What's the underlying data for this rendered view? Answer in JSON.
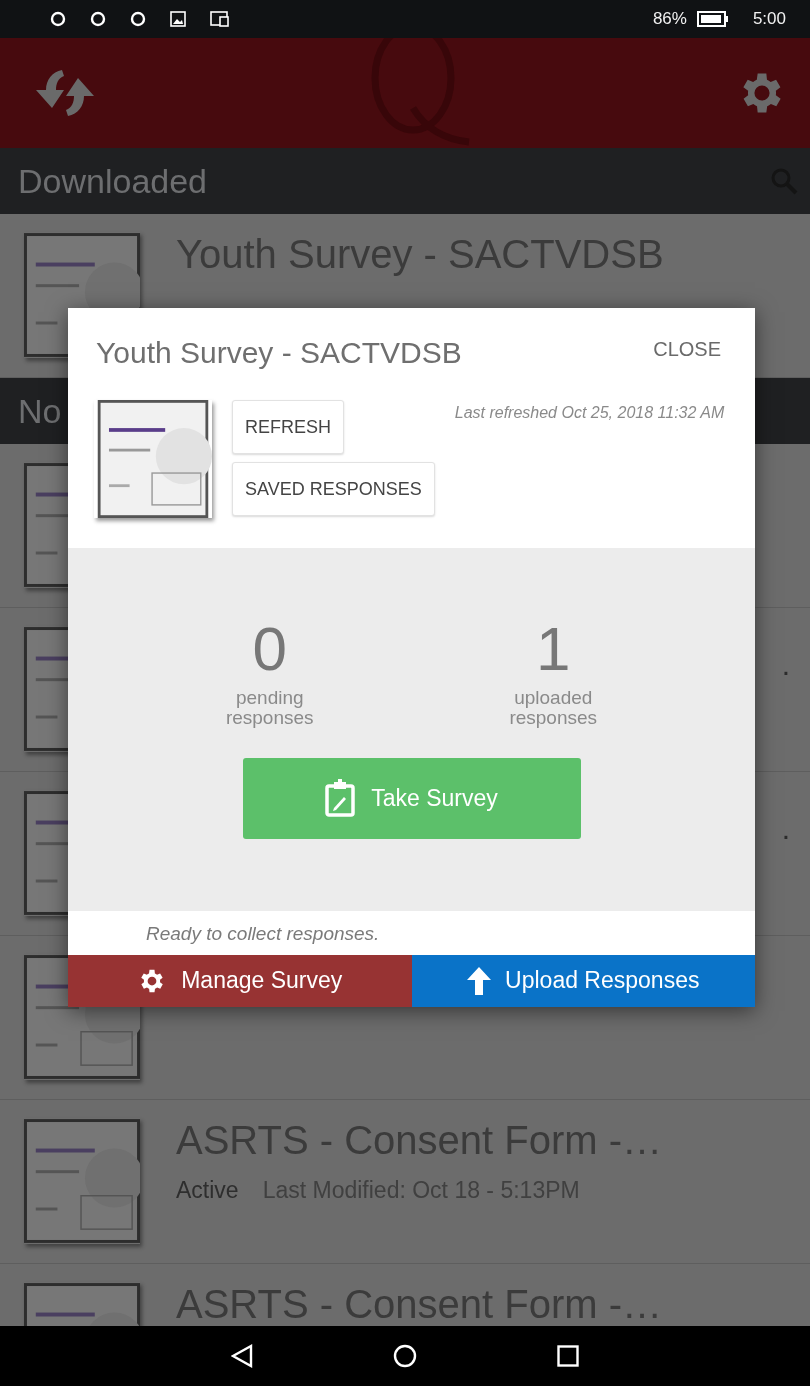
{
  "status_bar": {
    "battery": "86%",
    "time": "5:00"
  },
  "sections": [
    {
      "title": "Downloaded",
      "items": [
        {
          "kind": "listed",
          "title": "Youth Survey - SACTVDSB"
        }
      ]
    },
    {
      "title": "No",
      "items": [
        {
          "kind": "covered"
        },
        {
          "kind": "covered",
          "title_end": "."
        },
        {
          "kind": "covered",
          "title_end": "."
        },
        {
          "kind": "covered"
        },
        {
          "kind": "listed",
          "title": "ASRTS - Consent Form -…",
          "status": "Active",
          "modified": "Last Modified: Oct 18 - 5:13PM"
        },
        {
          "kind": "listed",
          "title": "ASRTS - Consent Form -…"
        }
      ]
    }
  ],
  "dialog": {
    "title": "Youth Survey - SACTVDSB",
    "close": "CLOSE",
    "buttons": [
      "REFRESH",
      "SAVED RESPONSES"
    ],
    "last_refreshed": "Last refreshed Oct 25, 2018 11:32 AM",
    "stats": [
      {
        "value": "0",
        "label": "pending responses"
      },
      {
        "value": "1",
        "label": "uploaded responses"
      }
    ],
    "primary_action": "Take Survey",
    "status": "Ready to collect responses.",
    "actions": [
      {
        "label": "Manage Survey",
        "kind": "manage"
      },
      {
        "label": "Upload Responses",
        "kind": "upload"
      }
    ]
  }
}
